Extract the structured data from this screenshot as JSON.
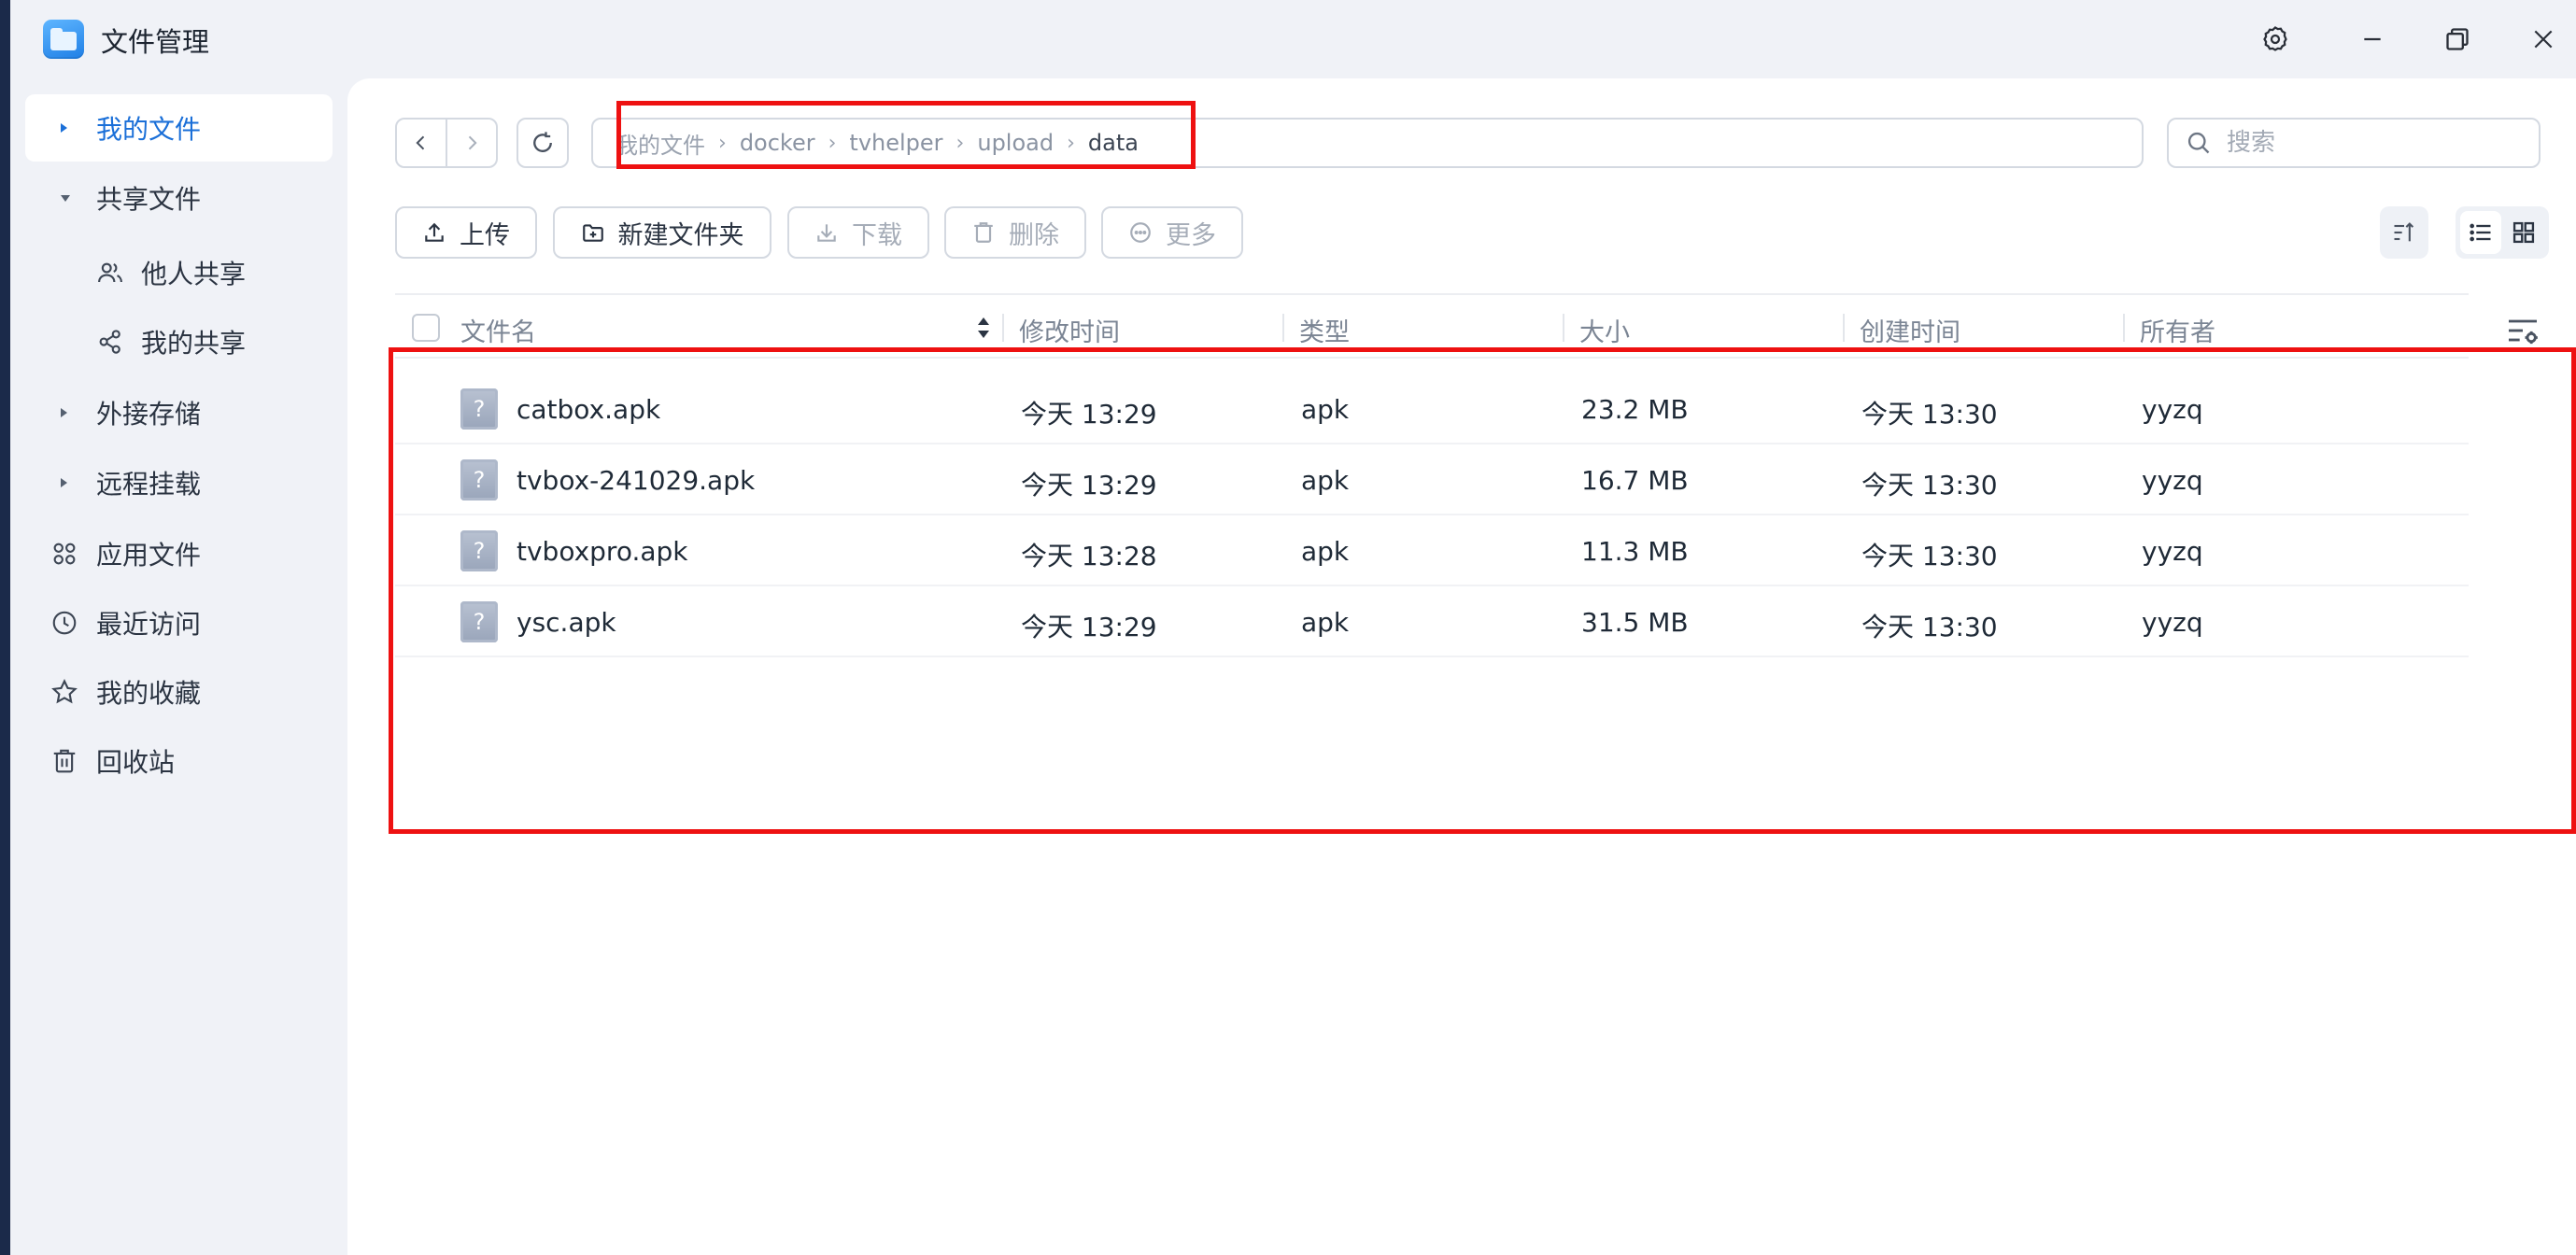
{
  "app": {
    "title": "文件管理"
  },
  "window_controls": {
    "settings": "gear-icon",
    "minimize": "minimize-icon",
    "maximize": "maximize-icon",
    "close": "close-icon"
  },
  "sidebar": {
    "items": [
      {
        "label": "我的文件",
        "icon": "caret-right",
        "active": true
      },
      {
        "label": "共享文件",
        "icon": "caret-down",
        "active": false
      },
      {
        "label": "他人共享",
        "icon": "users-icon",
        "sub": true
      },
      {
        "label": "我的共享",
        "icon": "share-icon",
        "sub": true
      },
      {
        "label": "外接存储",
        "icon": "caret-right"
      },
      {
        "label": "远程挂载",
        "icon": "caret-right"
      },
      {
        "label": "应用文件",
        "icon": "apps-icon"
      },
      {
        "label": "最近访问",
        "icon": "clock-icon"
      },
      {
        "label": "我的收藏",
        "icon": "star-icon"
      },
      {
        "label": "回收站",
        "icon": "trash-icon"
      }
    ]
  },
  "path": {
    "crumbs": [
      "我的文件",
      "docker",
      "tvhelper",
      "upload",
      "data"
    ],
    "separator": "›"
  },
  "search": {
    "placeholder": "搜索"
  },
  "toolbar": {
    "upload": "上传",
    "new_folder": "新建文件夹",
    "download": "下载",
    "delete": "删除",
    "more": "更多"
  },
  "table": {
    "columns": [
      "文件名",
      "修改时间",
      "类型",
      "大小",
      "创建时间",
      "所有者"
    ],
    "rows": [
      {
        "name": "catbox.apk",
        "modified": "今天 13:29",
        "type": "apk",
        "size": "23.2 MB",
        "created": "今天 13:30",
        "owner": "yyzq"
      },
      {
        "name": "tvbox-241029.apk",
        "modified": "今天 13:29",
        "type": "apk",
        "size": "16.7 MB",
        "created": "今天 13:30",
        "owner": "yyzq"
      },
      {
        "name": "tvboxpro.apk",
        "modified": "今天 13:28",
        "type": "apk",
        "size": "11.3 MB",
        "created": "今天 13:30",
        "owner": "yyzq"
      },
      {
        "name": "ysc.apk",
        "modified": "今天 13:29",
        "type": "apk",
        "size": "31.5 MB",
        "created": "今天 13:30",
        "owner": "yyzq"
      }
    ],
    "file_icon_glyph": "?"
  },
  "colors": {
    "accent": "#1a6fd8",
    "annotation": "#ee1111"
  }
}
